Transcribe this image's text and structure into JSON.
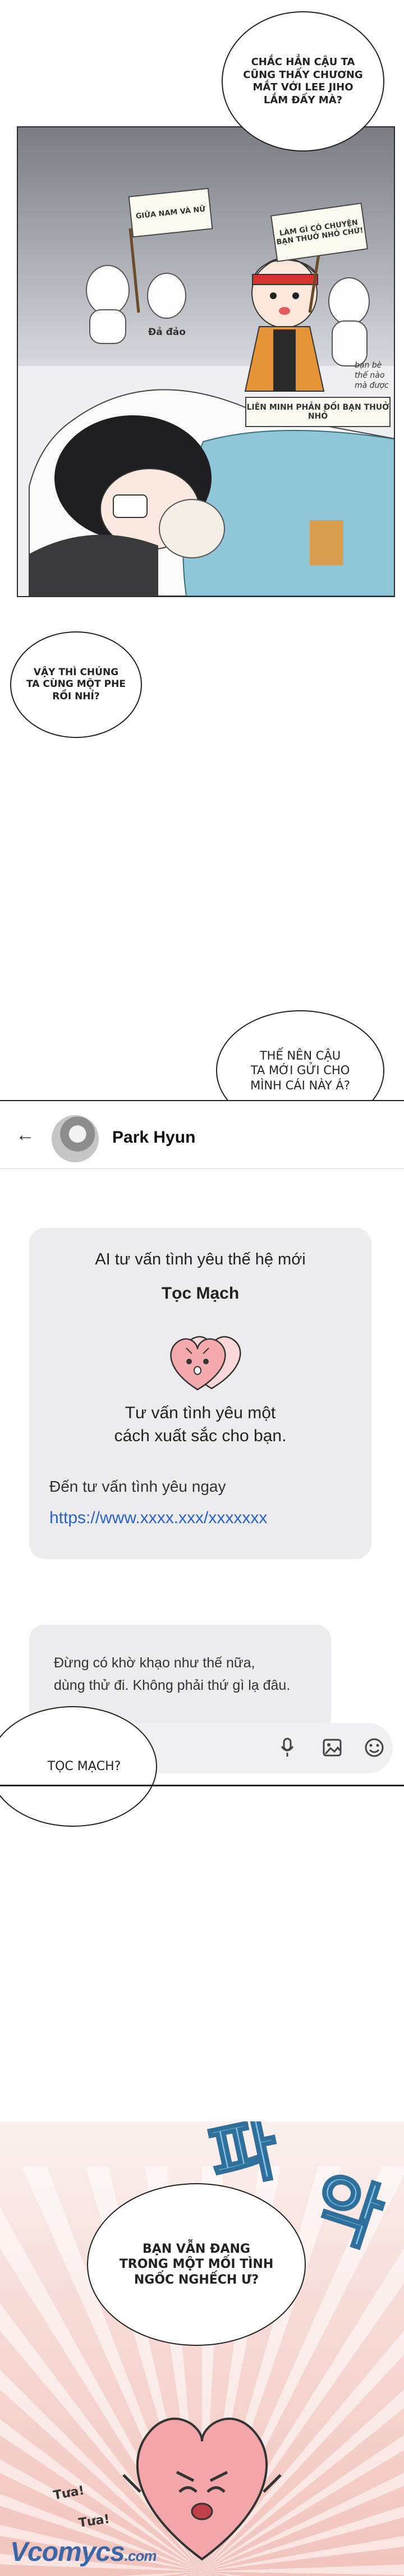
{
  "panel1": {
    "top_bubble": [
      "CHẮC HẲN CẬU TA",
      "CŨNG THẤY CHƯƠNG",
      "MẮT VỚI LEE JIHO",
      "LẮM ĐẤY MÀ?"
    ],
    "sign_left": [
      "GIỮA NAM VÀ NỮ"
    ],
    "sign_right": [
      "LÀM GÌ CÓ CHUYỆN",
      "BẠN THUỞ NHỎ CHỨ!"
    ],
    "shout_left": "Đả đảo",
    "shout_right": [
      "bạn bè thế nào",
      "mà được"
    ],
    "banner": "LIÊN MINH PHẢN ĐỐI BẠN THUỞ NHỎ"
  },
  "bubble_pair": [
    "VẬY THÌ CHÚNG",
    "TA CÙNG MỘT PHE",
    "RỒI NHỈ?"
  ],
  "bubble_sent": [
    "THẾ NÊN CẬU",
    "TA MỚI GỬI CHO",
    "MÌNH CÁI NÀY Á?"
  ],
  "chat": {
    "contact_name": "Park Hyun",
    "card": {
      "headline": "AI tư vấn tình yêu thế hệ mới",
      "brand": "Tọc Mạch",
      "desc": [
        "Tư vấn tình yêu một",
        "cách xuất sắc cho bạn."
      ],
      "cta": "Đến tư vấn tình yêu ngay",
      "link": "https://www.xxxx.xxx/xxxxxxx"
    },
    "sent_message": [
      "Đừng có khờ khạo như thế nữa,",
      "dùng thử đi. Không phải thứ gì lạ đâu."
    ],
    "icons": [
      "mic-icon",
      "image-icon",
      "emoji-icon"
    ]
  },
  "bubble_question": "TỌC MẠCH?",
  "panel3": {
    "sfx": [
      "파",
      "악"
    ],
    "bubble": [
      "BẠN VẪN ĐANG",
      "TRONG MỘT MỐI TÌNH",
      "NGỐC NGHẾCH Ư?"
    ],
    "small_sfx": [
      "Tưa!",
      "Tưa!"
    ]
  },
  "watermark": "Vcomycs",
  "watermark_suffix": ".com",
  "colors": {
    "link": "#2a63c9",
    "sfx": "#7fc2ea",
    "heart": "#f1a9a9"
  }
}
